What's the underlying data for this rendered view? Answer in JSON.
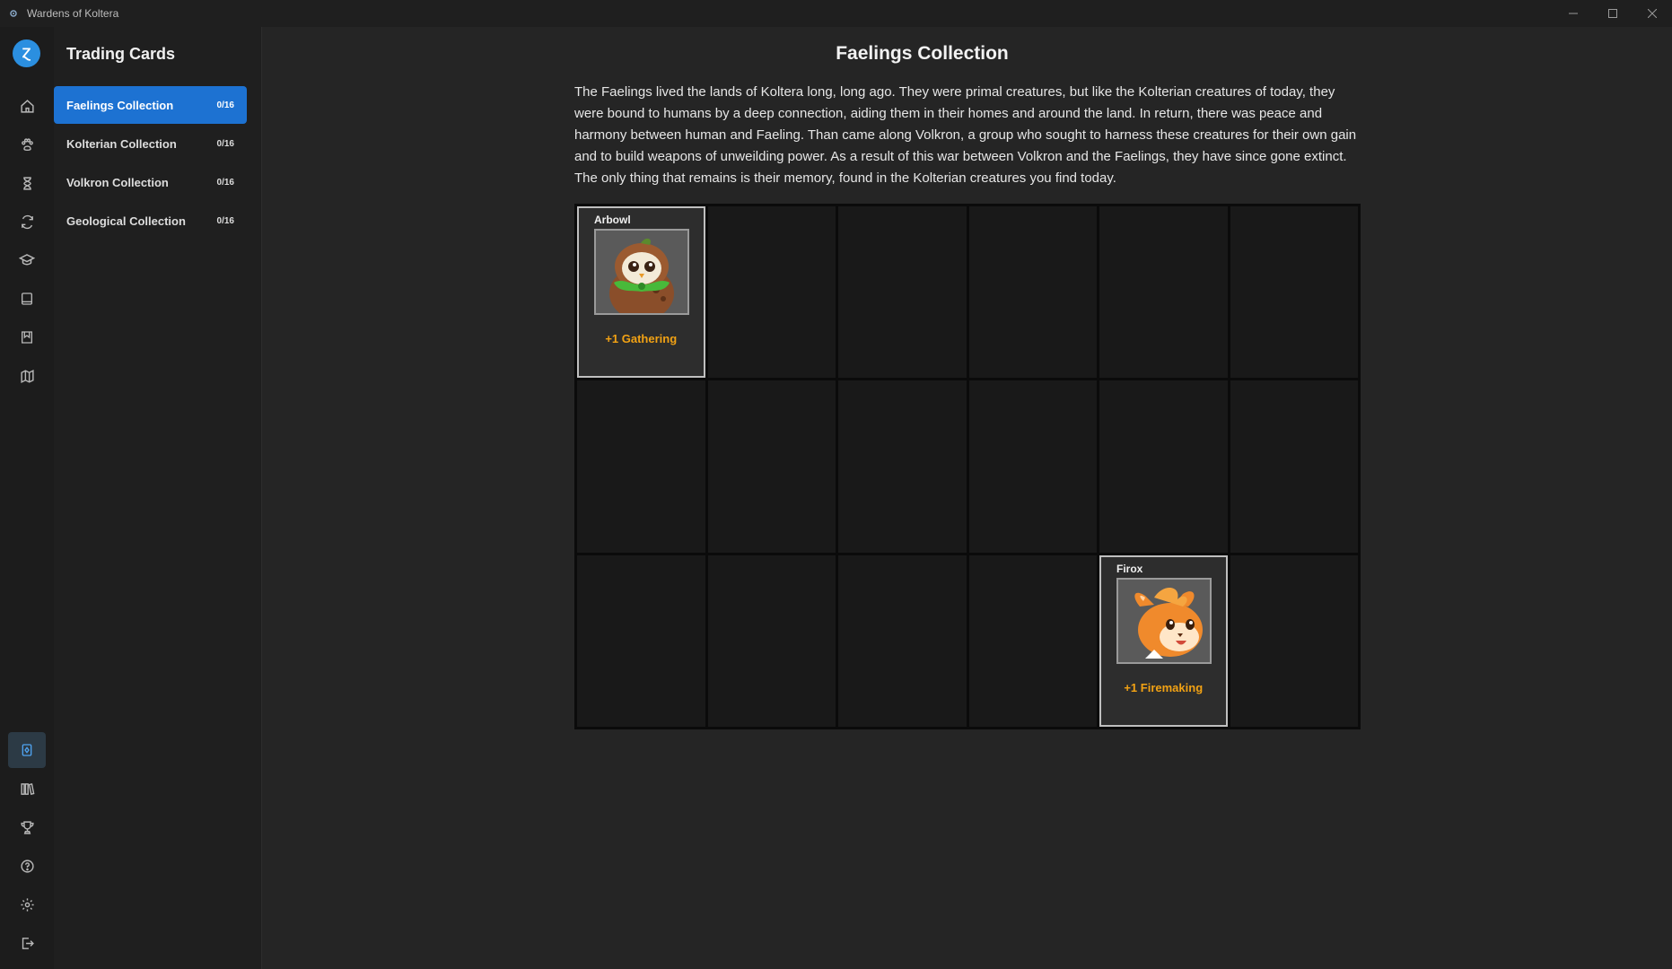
{
  "window": {
    "title": "Wardens of Koltera",
    "icon": "gear-icon",
    "controls": [
      "minimize-icon",
      "maximize-icon",
      "close-icon"
    ]
  },
  "rail": {
    "logo_glyph": "Ɀ",
    "top_icons": [
      "home-icon",
      "paw-icon",
      "hourglass-icon",
      "refresh-icon",
      "graduation-cap-icon",
      "book-icon",
      "bookmark-book-icon",
      "map-icon"
    ],
    "bottom_icons": [
      "cards-icon",
      "library-icon",
      "trophy-icon",
      "help-icon",
      "settings-icon",
      "logout-icon"
    ],
    "active": "cards-icon"
  },
  "sidebar": {
    "title": "Trading Cards",
    "collections": [
      {
        "label": "Faelings Collection",
        "count": "0/16",
        "active": true
      },
      {
        "label": "Kolterian Collection",
        "count": "0/16",
        "active": false
      },
      {
        "label": "Volkron Collection",
        "count": "0/16",
        "active": false
      },
      {
        "label": "Geological Collection",
        "count": "0/16",
        "active": false
      }
    ]
  },
  "main": {
    "title": "Faelings Collection",
    "description": "The Faelings lived the lands of Koltera long, long ago. They were primal creatures, but like the Kolterian creatures of today, they were bound to humans by a deep connection, aiding them in their homes and around the land. In return, there was peace and harmony between human and Faeling. Than came along Volkron, a group who sought to harness these creatures for their own gain and to build weapons of unweilding power. As a result of this war between Volkron and the Faelings, they have since gone extinct. The only thing that remains is their memory, found in the Kolterian creatures you find today."
  },
  "cards": [
    {
      "name": "Arbowl",
      "bonus": "+1 Gathering",
      "slot": 0,
      "art": "owl-creature"
    },
    {
      "name": "Firox",
      "bonus": "+1 Firemaking",
      "slot": 16,
      "art": "fox-creature"
    }
  ],
  "colors": {
    "accent": "#1d72d2",
    "bonus": "#f2a214",
    "logo": "#2b8fe0"
  }
}
